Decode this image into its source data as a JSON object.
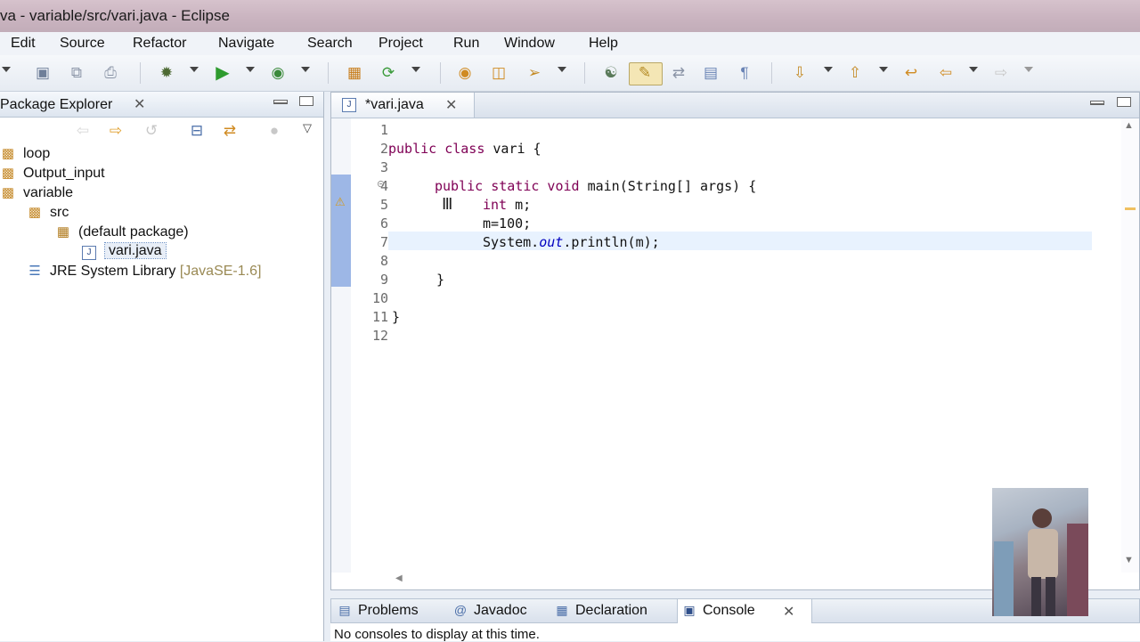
{
  "window": {
    "title": "va - variable/src/vari.java - Eclipse"
  },
  "menu": [
    "Edit",
    "Source",
    "Refactor",
    "Navigate",
    "Search",
    "Project",
    "Run",
    "Window",
    "Help"
  ],
  "package_explorer": {
    "title": "Package Explorer",
    "tree": [
      {
        "label": "loop",
        "icon": "project-folder-icon"
      },
      {
        "label": "Output_input",
        "icon": "project-folder-icon"
      },
      {
        "label": "variable",
        "icon": "project-folder-icon"
      },
      {
        "label": "src",
        "icon": "source-folder-icon"
      },
      {
        "label": "(default package)",
        "icon": "package-icon"
      },
      {
        "label": "vari.java",
        "icon": "java-file-icon"
      },
      {
        "label": "JRE System Library",
        "decoration": "[JavaSE-1.6]",
        "icon": "library-icon"
      }
    ]
  },
  "editor": {
    "tab_label": "*vari.java",
    "line_numbers": [
      "1",
      "2",
      "3",
      "4",
      "5",
      "6",
      "7",
      "8",
      "9",
      "10",
      "11",
      "12"
    ],
    "lines": {
      "l2_kw": "public class",
      "l2_rest": " vari {",
      "l4_kw": "public static void",
      "l4_rest": " main(String[] args) {",
      "l5_kw": "int",
      "l5_rest": " m;",
      "l6": "m=100;",
      "l7_pre": "System.",
      "l7_field": "out",
      "l7_post": ".println(m);",
      "l9": "}",
      "l11": "}"
    }
  },
  "bottom_panel": {
    "tabs": [
      "Problems",
      "Javadoc",
      "Declaration",
      "Console"
    ],
    "message": "No consoles to display at this time."
  },
  "colors": {
    "keyword": "#7f0055",
    "static_field": "#0000c0",
    "current_line": "#e8f2fe",
    "change_ruler": "#9db7e6"
  }
}
